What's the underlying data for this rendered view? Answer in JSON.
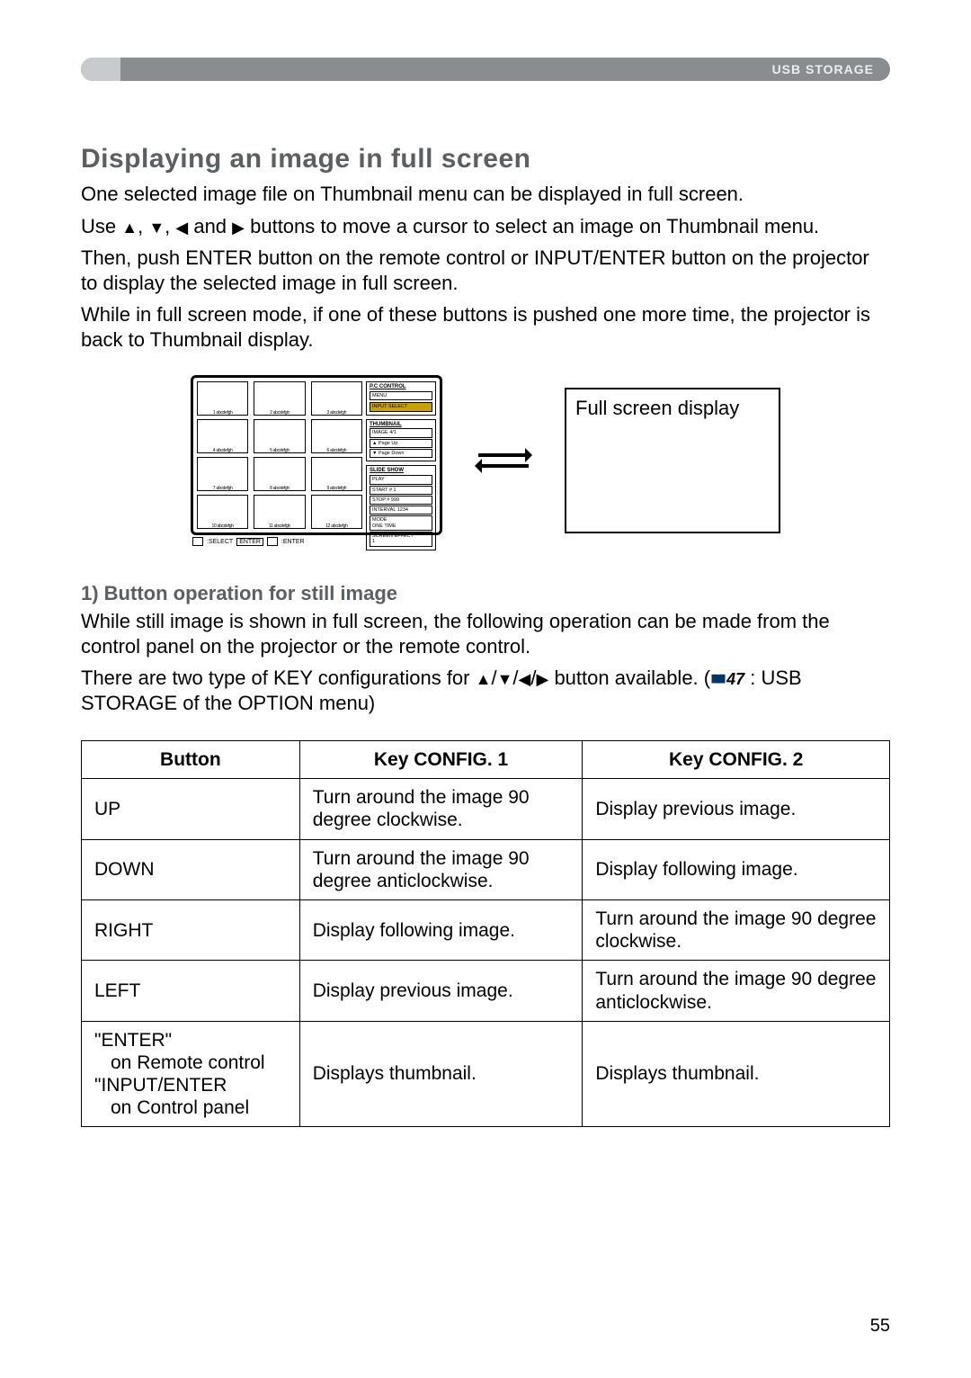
{
  "header": {
    "label": "USB STORAGE"
  },
  "section_title": "Displaying an image in full screen",
  "paragraphs": {
    "p1": "One selected image file on Thumbnail menu can be displayed in full screen.",
    "p2_pre": "Use ",
    "p2_post": " buttons to move a cursor to select an image on Thumbnail menu.",
    "p3": "Then, push ENTER button on the remote control or INPUT/ENTER button on the projector to display the selected image in full screen.",
    "p4": "While in full screen mode, if one of these buttons is pushed one more time, the projector is back to Thumbnail display."
  },
  "arrows_separator": " and ",
  "diagram": {
    "thumb_caption_prefix": "abcdefgh",
    "thumb_captions": [
      "1",
      "2",
      "3",
      "4",
      "5",
      "6",
      "7",
      "8",
      "9",
      "10",
      "11",
      "12"
    ],
    "side": {
      "pc_control": "P.C CONTROL",
      "menu": "MENU",
      "input_select": "INPUT SELECT",
      "thumbnail": "THUMBNAIL",
      "image_line": "IMAGE    4/1",
      "page_up": "▲ Page Up",
      "page_down": "▼ Page Down",
      "slide_show": "SLIDE SHOW",
      "play": "PLAY",
      "start": "START   # 1",
      "stop": "STOP    # 999",
      "interval": "INTERVAL  1234",
      "mode": "MODE",
      "one_time": "  ONE TIME",
      "screen_effect": "SCREEN EFFECT",
      "effect_val": "   1"
    },
    "footer": {
      "select": ":SELECT",
      "enter": "ENTER",
      "enter2": ":ENTER"
    },
    "fullscreen_label": "Full screen display"
  },
  "sub_heading": "1) Button operation for still image",
  "sub_paragraphs": {
    "s1": "While still image is shown in full screen, the following operation can be made from the control panel on the projector or the remote control.",
    "s2_pre": "There are two type of KEY configurations for ",
    "s2_mid": " button available. (",
    "s2_ref": "47",
    "s2_post": " : USB STORAGE of the OPTION menu)"
  },
  "table": {
    "headers": {
      "button": "Button",
      "k1": "Key CONFIG. 1",
      "k2": "Key CONFIG. 2"
    },
    "rows": [
      {
        "button": "UP",
        "k1": "Turn around the image 90 degree clockwise.",
        "k2": "Display previous image."
      },
      {
        "button": "DOWN",
        "k1": "Turn around the image 90 degree anticlockwise.",
        "k2": "Display following image."
      },
      {
        "button": "RIGHT",
        "k1": "Display following image.",
        "k2": "Turn around the image 90 degree clockwise."
      },
      {
        "button": "LEFT",
        "k1": "Display previous image.",
        "k2": "Turn around the image 90 degree anticlockwise."
      }
    ],
    "last_row": {
      "b1": "\"ENTER\"",
      "b2": "on Remote control",
      "b3": "\"INPUT/ENTER",
      "b4": "on Control panel",
      "k1": "Displays thumbnail.",
      "k2": "Displays thumbnail."
    }
  },
  "page_number": "55"
}
